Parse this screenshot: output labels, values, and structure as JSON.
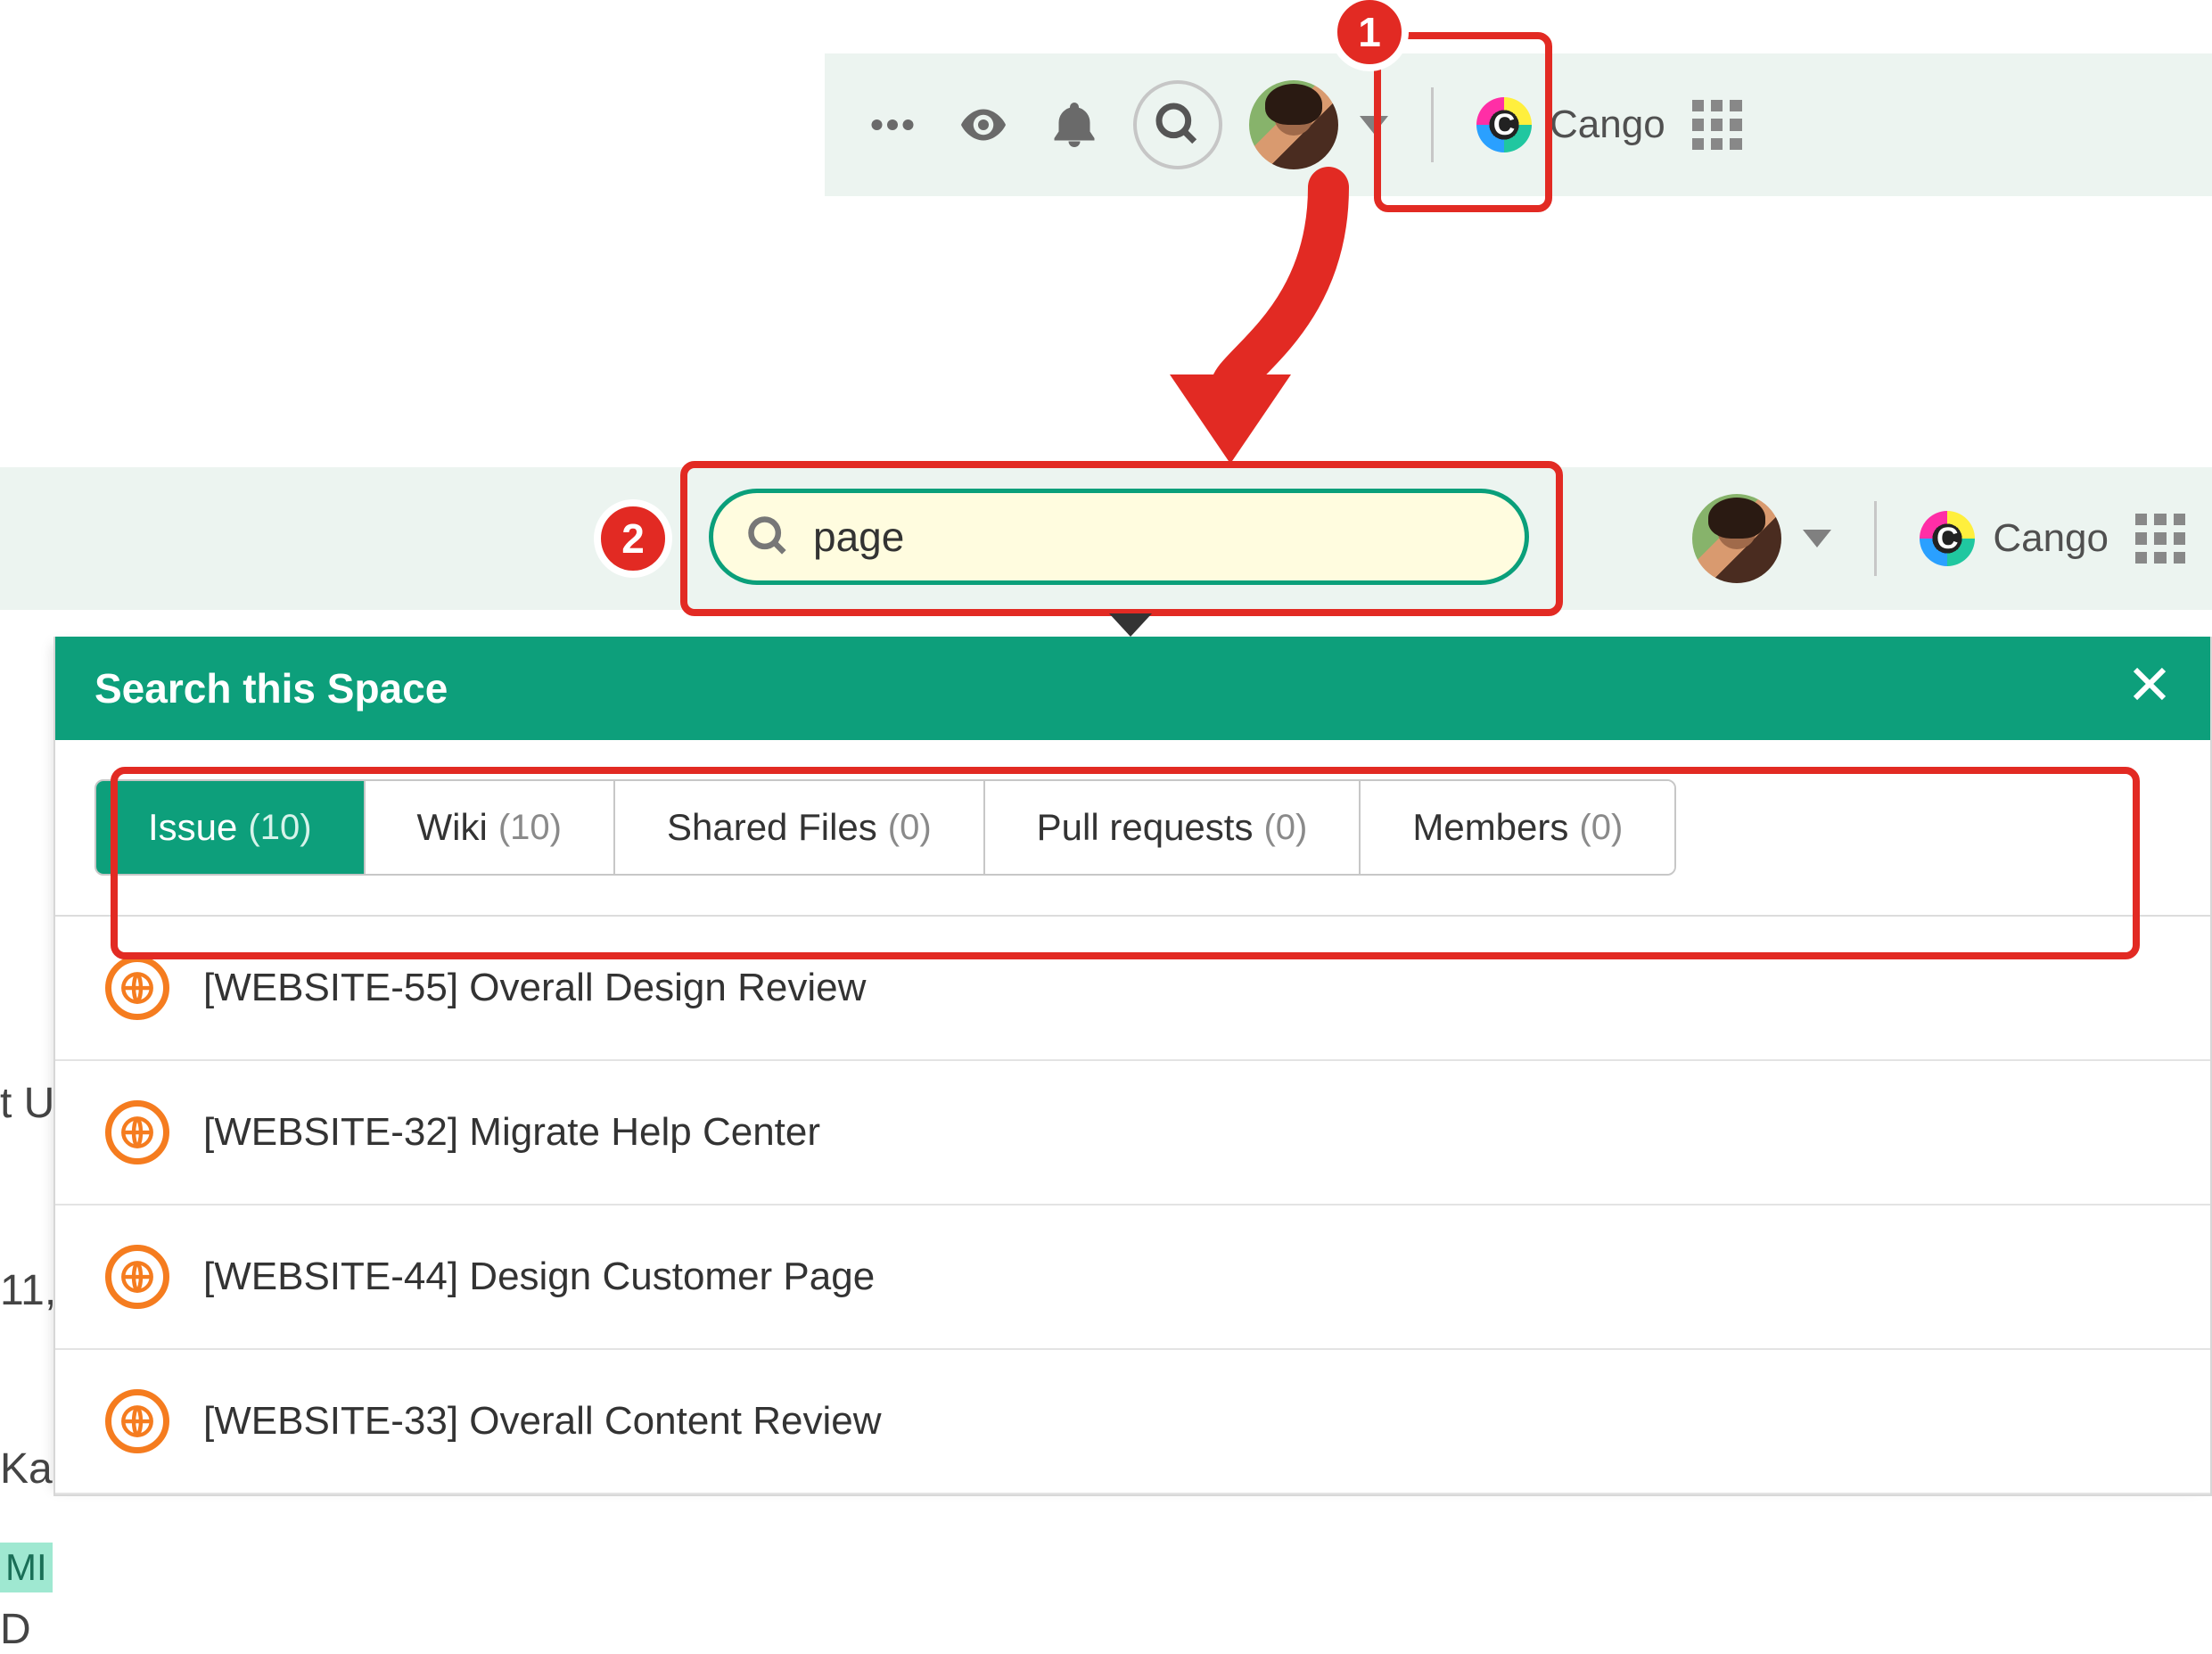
{
  "workspace": {
    "name": "Cango",
    "logo_letter": "C"
  },
  "search": {
    "value": "page",
    "panel_title": "Search this Space"
  },
  "tabs": [
    {
      "label": "Issue",
      "count": "(10)",
      "active": true
    },
    {
      "label": "Wiki",
      "count": "(10)",
      "active": false
    },
    {
      "label": "Shared Files",
      "count": "(0)",
      "active": false
    },
    {
      "label": "Pull requests",
      "count": "(0)",
      "active": false
    },
    {
      "label": "Members",
      "count": "(0)",
      "active": false
    }
  ],
  "results": [
    {
      "title": "[WEBSITE-55] Overall Design Review"
    },
    {
      "title": "[WEBSITE-32] Migrate Help Center"
    },
    {
      "title": "[WEBSITE-44] Design Customer Page"
    },
    {
      "title": "[WEBSITE-33] Overall Content Review"
    }
  ],
  "annotations": {
    "marker1": "1",
    "marker2": "2"
  },
  "background_fragments": {
    "a": "t U",
    "b": "11,",
    "c": "Ka",
    "d": "MI",
    "e": "D"
  }
}
